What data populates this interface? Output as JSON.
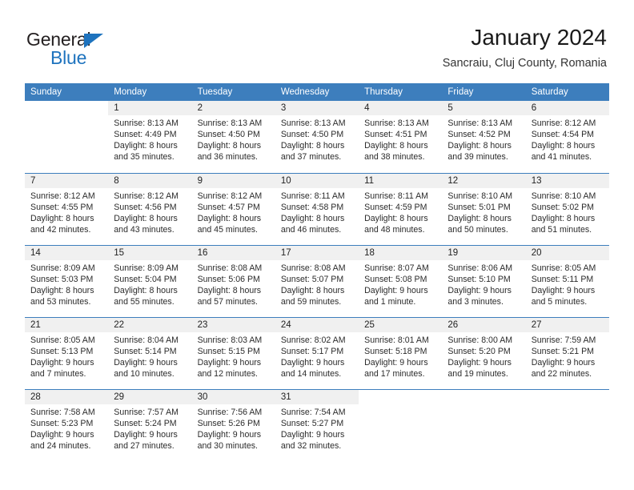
{
  "brand": {
    "name_top": "General",
    "name_bottom": "Blue",
    "accent_color": "#1e73be",
    "triangle_icon": "triangle-icon"
  },
  "header": {
    "title": "January 2024",
    "location": "Sancraiu, Cluj County, Romania"
  },
  "calendar": {
    "header_bg": "#3d7ebd",
    "daynum_bg": "#f0f0f0",
    "weekday_headers": [
      "Sunday",
      "Monday",
      "Tuesday",
      "Wednesday",
      "Thursday",
      "Friday",
      "Saturday"
    ],
    "weeks": [
      [
        {
          "day": "",
          "sunrise": "",
          "sunset": "",
          "daylight_1": "",
          "daylight_2": "",
          "blank": true
        },
        {
          "day": "1",
          "sunrise": "Sunrise: 8:13 AM",
          "sunset": "Sunset: 4:49 PM",
          "daylight_1": "Daylight: 8 hours",
          "daylight_2": "and 35 minutes."
        },
        {
          "day": "2",
          "sunrise": "Sunrise: 8:13 AM",
          "sunset": "Sunset: 4:50 PM",
          "daylight_1": "Daylight: 8 hours",
          "daylight_2": "and 36 minutes."
        },
        {
          "day": "3",
          "sunrise": "Sunrise: 8:13 AM",
          "sunset": "Sunset: 4:50 PM",
          "daylight_1": "Daylight: 8 hours",
          "daylight_2": "and 37 minutes."
        },
        {
          "day": "4",
          "sunrise": "Sunrise: 8:13 AM",
          "sunset": "Sunset: 4:51 PM",
          "daylight_1": "Daylight: 8 hours",
          "daylight_2": "and 38 minutes."
        },
        {
          "day": "5",
          "sunrise": "Sunrise: 8:13 AM",
          "sunset": "Sunset: 4:52 PM",
          "daylight_1": "Daylight: 8 hours",
          "daylight_2": "and 39 minutes."
        },
        {
          "day": "6",
          "sunrise": "Sunrise: 8:12 AM",
          "sunset": "Sunset: 4:54 PM",
          "daylight_1": "Daylight: 8 hours",
          "daylight_2": "and 41 minutes."
        }
      ],
      [
        {
          "day": "7",
          "sunrise": "Sunrise: 8:12 AM",
          "sunset": "Sunset: 4:55 PM",
          "daylight_1": "Daylight: 8 hours",
          "daylight_2": "and 42 minutes."
        },
        {
          "day": "8",
          "sunrise": "Sunrise: 8:12 AM",
          "sunset": "Sunset: 4:56 PM",
          "daylight_1": "Daylight: 8 hours",
          "daylight_2": "and 43 minutes."
        },
        {
          "day": "9",
          "sunrise": "Sunrise: 8:12 AM",
          "sunset": "Sunset: 4:57 PM",
          "daylight_1": "Daylight: 8 hours",
          "daylight_2": "and 45 minutes."
        },
        {
          "day": "10",
          "sunrise": "Sunrise: 8:11 AM",
          "sunset": "Sunset: 4:58 PM",
          "daylight_1": "Daylight: 8 hours",
          "daylight_2": "and 46 minutes."
        },
        {
          "day": "11",
          "sunrise": "Sunrise: 8:11 AM",
          "sunset": "Sunset: 4:59 PM",
          "daylight_1": "Daylight: 8 hours",
          "daylight_2": "and 48 minutes."
        },
        {
          "day": "12",
          "sunrise": "Sunrise: 8:10 AM",
          "sunset": "Sunset: 5:01 PM",
          "daylight_1": "Daylight: 8 hours",
          "daylight_2": "and 50 minutes."
        },
        {
          "day": "13",
          "sunrise": "Sunrise: 8:10 AM",
          "sunset": "Sunset: 5:02 PM",
          "daylight_1": "Daylight: 8 hours",
          "daylight_2": "and 51 minutes."
        }
      ],
      [
        {
          "day": "14",
          "sunrise": "Sunrise: 8:09 AM",
          "sunset": "Sunset: 5:03 PM",
          "daylight_1": "Daylight: 8 hours",
          "daylight_2": "and 53 minutes."
        },
        {
          "day": "15",
          "sunrise": "Sunrise: 8:09 AM",
          "sunset": "Sunset: 5:04 PM",
          "daylight_1": "Daylight: 8 hours",
          "daylight_2": "and 55 minutes."
        },
        {
          "day": "16",
          "sunrise": "Sunrise: 8:08 AM",
          "sunset": "Sunset: 5:06 PM",
          "daylight_1": "Daylight: 8 hours",
          "daylight_2": "and 57 minutes."
        },
        {
          "day": "17",
          "sunrise": "Sunrise: 8:08 AM",
          "sunset": "Sunset: 5:07 PM",
          "daylight_1": "Daylight: 8 hours",
          "daylight_2": "and 59 minutes."
        },
        {
          "day": "18",
          "sunrise": "Sunrise: 8:07 AM",
          "sunset": "Sunset: 5:08 PM",
          "daylight_1": "Daylight: 9 hours",
          "daylight_2": "and 1 minute."
        },
        {
          "day": "19",
          "sunrise": "Sunrise: 8:06 AM",
          "sunset": "Sunset: 5:10 PM",
          "daylight_1": "Daylight: 9 hours",
          "daylight_2": "and 3 minutes."
        },
        {
          "day": "20",
          "sunrise": "Sunrise: 8:05 AM",
          "sunset": "Sunset: 5:11 PM",
          "daylight_1": "Daylight: 9 hours",
          "daylight_2": "and 5 minutes."
        }
      ],
      [
        {
          "day": "21",
          "sunrise": "Sunrise: 8:05 AM",
          "sunset": "Sunset: 5:13 PM",
          "daylight_1": "Daylight: 9 hours",
          "daylight_2": "and 7 minutes."
        },
        {
          "day": "22",
          "sunrise": "Sunrise: 8:04 AM",
          "sunset": "Sunset: 5:14 PM",
          "daylight_1": "Daylight: 9 hours",
          "daylight_2": "and 10 minutes."
        },
        {
          "day": "23",
          "sunrise": "Sunrise: 8:03 AM",
          "sunset": "Sunset: 5:15 PM",
          "daylight_1": "Daylight: 9 hours",
          "daylight_2": "and 12 minutes."
        },
        {
          "day": "24",
          "sunrise": "Sunrise: 8:02 AM",
          "sunset": "Sunset: 5:17 PM",
          "daylight_1": "Daylight: 9 hours",
          "daylight_2": "and 14 minutes."
        },
        {
          "day": "25",
          "sunrise": "Sunrise: 8:01 AM",
          "sunset": "Sunset: 5:18 PM",
          "daylight_1": "Daylight: 9 hours",
          "daylight_2": "and 17 minutes."
        },
        {
          "day": "26",
          "sunrise": "Sunrise: 8:00 AM",
          "sunset": "Sunset: 5:20 PM",
          "daylight_1": "Daylight: 9 hours",
          "daylight_2": "and 19 minutes."
        },
        {
          "day": "27",
          "sunrise": "Sunrise: 7:59 AM",
          "sunset": "Sunset: 5:21 PM",
          "daylight_1": "Daylight: 9 hours",
          "daylight_2": "and 22 minutes."
        }
      ],
      [
        {
          "day": "28",
          "sunrise": "Sunrise: 7:58 AM",
          "sunset": "Sunset: 5:23 PM",
          "daylight_1": "Daylight: 9 hours",
          "daylight_2": "and 24 minutes."
        },
        {
          "day": "29",
          "sunrise": "Sunrise: 7:57 AM",
          "sunset": "Sunset: 5:24 PM",
          "daylight_1": "Daylight: 9 hours",
          "daylight_2": "and 27 minutes."
        },
        {
          "day": "30",
          "sunrise": "Sunrise: 7:56 AM",
          "sunset": "Sunset: 5:26 PM",
          "daylight_1": "Daylight: 9 hours",
          "daylight_2": "and 30 minutes."
        },
        {
          "day": "31",
          "sunrise": "Sunrise: 7:54 AM",
          "sunset": "Sunset: 5:27 PM",
          "daylight_1": "Daylight: 9 hours",
          "daylight_2": "and 32 minutes."
        },
        {
          "day": "",
          "sunrise": "",
          "sunset": "",
          "daylight_1": "",
          "daylight_2": "",
          "blank": true
        },
        {
          "day": "",
          "sunrise": "",
          "sunset": "",
          "daylight_1": "",
          "daylight_2": "",
          "blank": true
        },
        {
          "day": "",
          "sunrise": "",
          "sunset": "",
          "daylight_1": "",
          "daylight_2": "",
          "blank": true
        }
      ]
    ]
  }
}
